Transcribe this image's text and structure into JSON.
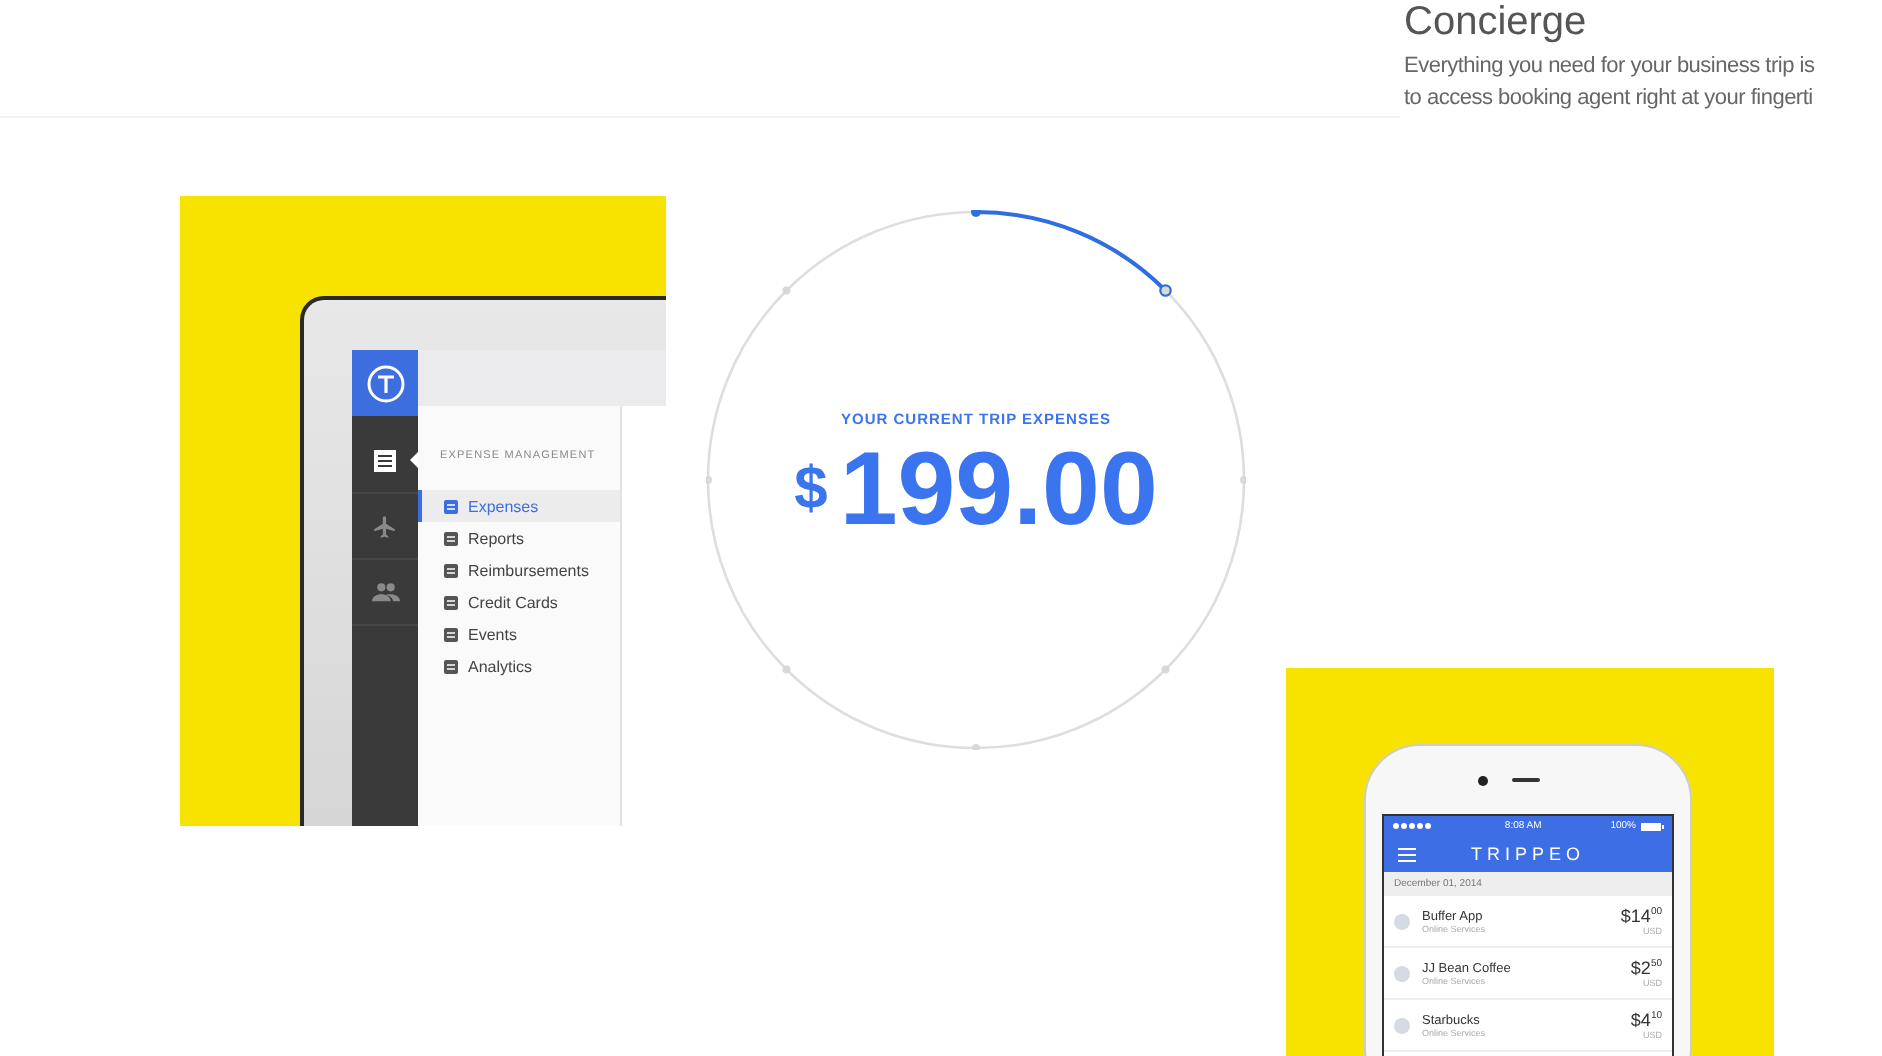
{
  "section": {
    "heading": "Concierge",
    "lines": [
      "Everything you need for your business trip is",
      "to access booking agent right at your fingerti"
    ]
  },
  "laptop": {
    "rail": [
      {
        "selected": true
      },
      {
        "selected": false
      },
      {
        "selected": false
      }
    ],
    "menu_title": "EXPENSE MANAGEMENT",
    "menu": [
      {
        "label": "Expenses",
        "selected": true
      },
      {
        "label": "Reports",
        "selected": false
      },
      {
        "label": "Reimbursements",
        "selected": false
      },
      {
        "label": "Credit Cards",
        "selected": false
      },
      {
        "label": "Events",
        "selected": false
      },
      {
        "label": "Analytics",
        "selected": false
      }
    ]
  },
  "gauge": {
    "label": "YOUR CURRENT TRIP EXPENSES",
    "currency": "$",
    "amount": "199.00"
  },
  "phone": {
    "status": {
      "time": "8:08 AM",
      "battery": "100%"
    },
    "brand": "TRIPPEO",
    "date": "December 01, 2014",
    "rows": [
      {
        "name": "Buffer App",
        "category": "Online Services",
        "amount": "$14$^{00}$",
        "currency": "USD"
      },
      {
        "name": "JJ Bean Coffee",
        "category": "Online Services",
        "amount": "$2$^{50}$",
        "currency": "USD"
      },
      {
        "name": "Starbucks",
        "category": "Online Services",
        "amount": "$4$^{10}$",
        "currency": "USD"
      }
    ]
  }
}
